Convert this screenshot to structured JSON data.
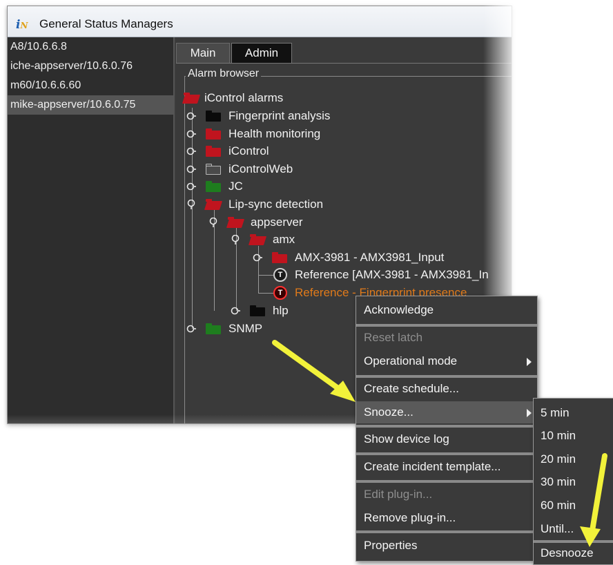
{
  "window": {
    "title": "General Status Managers"
  },
  "servers": [
    {
      "label": "A8/10.6.6.8"
    },
    {
      "label": "iche-appserver/10.6.0.76"
    },
    {
      "label": "m60/10.6.6.60"
    },
    {
      "label": "mike-appserver/10.6.0.75",
      "selected": true
    }
  ],
  "tabs": [
    {
      "label": "Main",
      "active": true
    },
    {
      "label": "Admin",
      "active": false
    }
  ],
  "alarm_browser": {
    "title": "Alarm browser",
    "tree": [
      {
        "label": "iControl alarms",
        "icon": "red-folder-open"
      },
      {
        "label": "Fingerprint analysis",
        "icon": "black-folder"
      },
      {
        "label": "Health monitoring",
        "icon": "red-folder"
      },
      {
        "label": "iControl",
        "icon": "red-folder"
      },
      {
        "label": "iControlWeb",
        "icon": "gray-folder"
      },
      {
        "label": "JC",
        "icon": "green-folder"
      },
      {
        "label": "Lip-sync detection",
        "icon": "red-folder-open"
      },
      {
        "label": "appserver",
        "icon": "red-folder-open"
      },
      {
        "label": "amx",
        "icon": "red-folder-open"
      },
      {
        "label": "AMX-3981 - AMX3981_Input",
        "icon": "red-folder"
      },
      {
        "label": "Reference [AMX-3981 - AMX3981_In",
        "icon": "t-alarm-icon"
      },
      {
        "label": "Reference - Fingerprint presence",
        "icon": "t-alarm-icon",
        "status": "alarm"
      },
      {
        "label": "hlp",
        "icon": "black-folder"
      },
      {
        "label": "SNMP",
        "icon": "green-folder"
      }
    ]
  },
  "context_menu": {
    "items": [
      {
        "label": "Acknowledge",
        "enabled": true
      },
      {
        "label": "Reset latch",
        "enabled": false
      },
      {
        "label": "Operational mode",
        "enabled": true,
        "submenu": true
      },
      {
        "label": "Create schedule...",
        "enabled": true
      },
      {
        "label": "Snooze...",
        "enabled": true,
        "submenu": true,
        "highlighted": true
      },
      {
        "label": "Show device log",
        "enabled": true
      },
      {
        "label": "Create incident template...",
        "enabled": true
      },
      {
        "label": "Edit plug-in...",
        "enabled": false
      },
      {
        "label": "Remove plug-in...",
        "enabled": true
      },
      {
        "label": "Properties",
        "enabled": true
      }
    ]
  },
  "snooze_menu": {
    "items": [
      {
        "label": "5 min"
      },
      {
        "label": "10 min"
      },
      {
        "label": "20 min"
      },
      {
        "label": "30 min"
      },
      {
        "label": "60 min"
      },
      {
        "label": "Until..."
      },
      {
        "label": "Desnooze"
      }
    ]
  },
  "colors": {
    "annotation_arrow": "#f2f23a",
    "alarm_text": "#e07a1a",
    "panel_bg": "#3a3a3a"
  }
}
